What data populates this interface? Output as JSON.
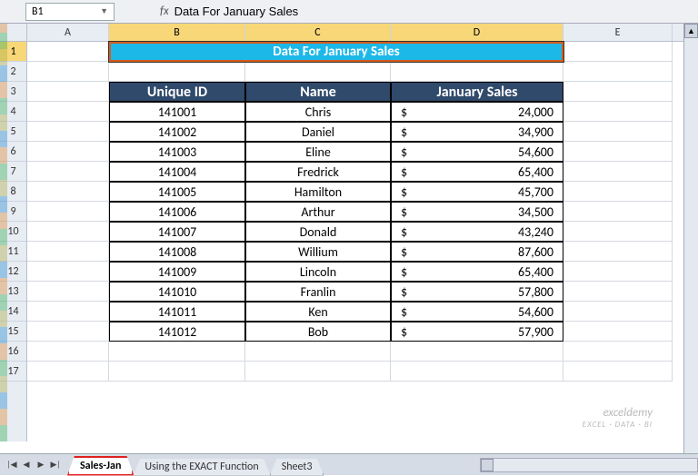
{
  "formula_bar": {
    "cell_ref": "B1",
    "fx_label": "fx",
    "formula": "Data For January Sales"
  },
  "columns": [
    "A",
    "B",
    "C",
    "D",
    "E"
  ],
  "selected_cols": [
    "B",
    "C",
    "D"
  ],
  "row_count": 17,
  "selected_row": 1,
  "title_cell": "Data For January Sales",
  "headers": {
    "id": "Unique ID",
    "name": "Name",
    "sales": "January Sales"
  },
  "currency": "$",
  "chart_data": {
    "type": "table",
    "title": "Data For January Sales",
    "columns": [
      "Unique ID",
      "Name",
      "January Sales"
    ],
    "rows": [
      {
        "id": "141001",
        "name": "Chris",
        "sales": "24,000"
      },
      {
        "id": "141002",
        "name": "Daniel",
        "sales": "34,900"
      },
      {
        "id": "141003",
        "name": "Eline",
        "sales": "54,600"
      },
      {
        "id": "141004",
        "name": "Fredrick",
        "sales": "65,400"
      },
      {
        "id": "141005",
        "name": "Hamilton",
        "sales": "45,700"
      },
      {
        "id": "141006",
        "name": "Arthur",
        "sales": "34,500"
      },
      {
        "id": "141007",
        "name": "Donald",
        "sales": "43,240"
      },
      {
        "id": "141008",
        "name": "Willium",
        "sales": "87,600"
      },
      {
        "id": "141009",
        "name": "Lincoln",
        "sales": "65,400"
      },
      {
        "id": "141010",
        "name": "Franlin",
        "sales": "57,800"
      },
      {
        "id": "141011",
        "name": "Ken",
        "sales": "54,600"
      },
      {
        "id": "141012",
        "name": "Bob",
        "sales": "57,900"
      }
    ]
  },
  "tabs": [
    {
      "label": "Sales-Jan",
      "active": true
    },
    {
      "label": "Using the EXACT Function",
      "active": false
    },
    {
      "label": "Sheet3",
      "active": false
    }
  ],
  "watermark": {
    "brand": "exceldemy",
    "tagline": "EXCEL · DATA · BI"
  }
}
